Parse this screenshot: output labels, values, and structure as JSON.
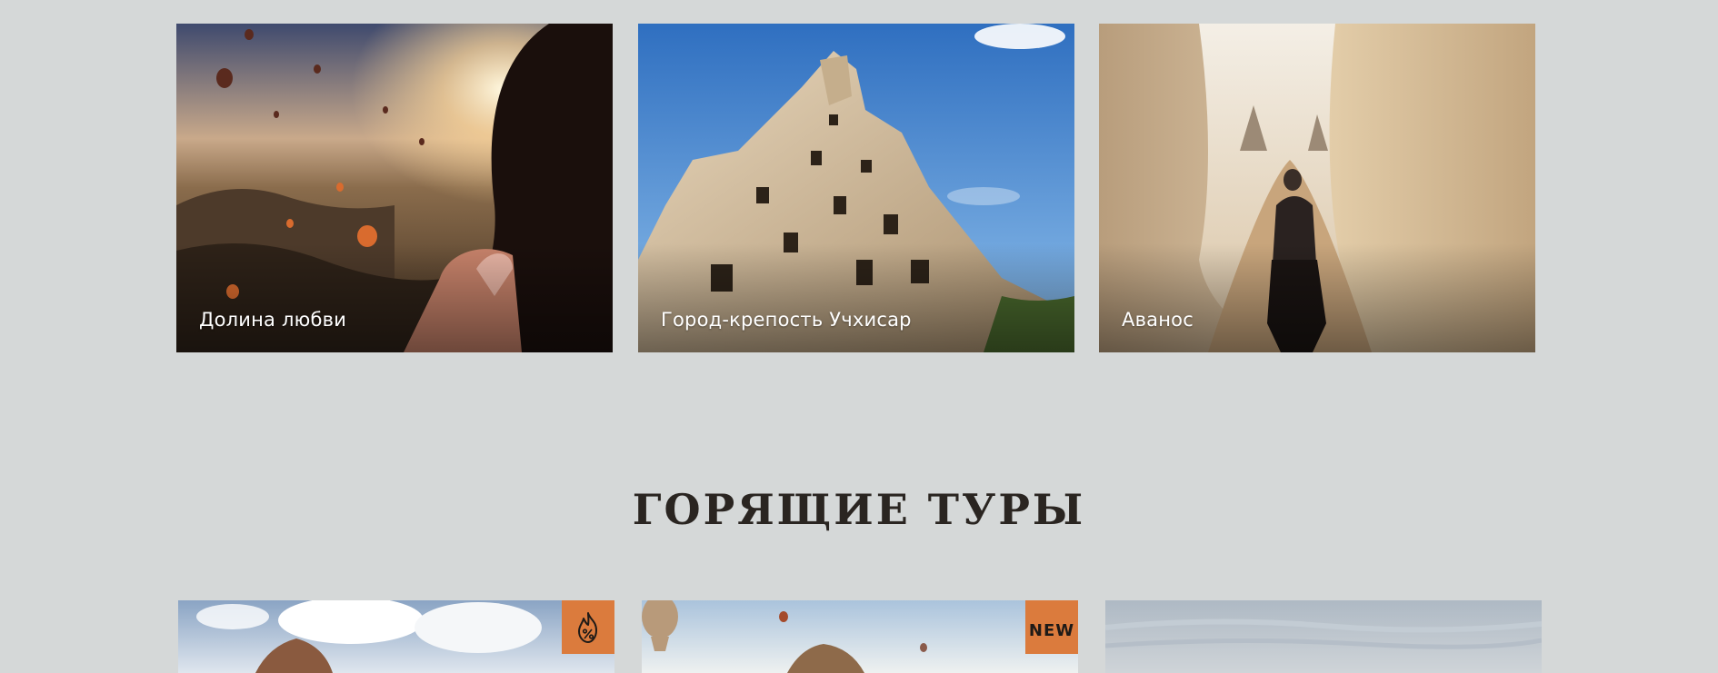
{
  "gallery": [
    {
      "caption": "Долина любви",
      "icon": "hot-air-balloons-photo"
    },
    {
      "caption": "Город-крепость Учхисар",
      "icon": "rock-castle-photo"
    },
    {
      "caption": "Аванос",
      "icon": "canyon-horse-rider-photo"
    }
  ],
  "hot_tours": {
    "title": "ГОРЯЩИЕ ТУРЫ",
    "cards": [
      {
        "badge_icon": "fire-percent-icon"
      },
      {
        "badge": "NEW"
      },
      {}
    ]
  },
  "colors": {
    "page_background": "#d5d8d8",
    "badge": "#db7b3d",
    "title": "#2a2521"
  }
}
